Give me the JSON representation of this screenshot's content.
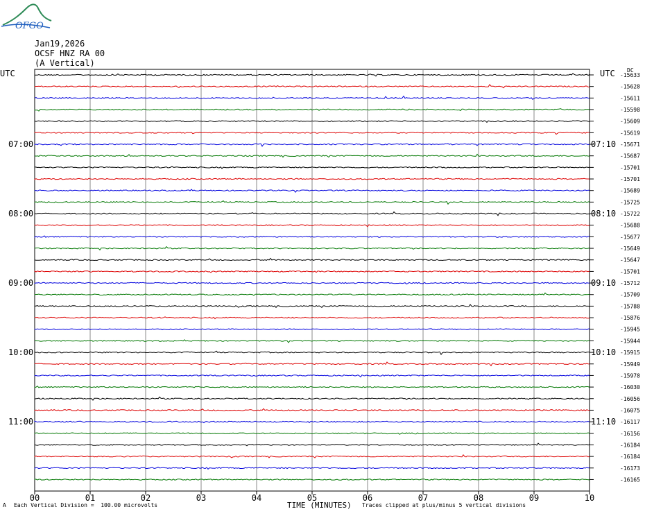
{
  "logo": {
    "text": "OFGO"
  },
  "header": {
    "date": "Jan19,2026",
    "station": "OCSF HNZ RA 00",
    "component": "(A Vertical)"
  },
  "left_timezone": "UTC",
  "right_timezone": "UTC",
  "dc_label": "DC",
  "footer": {
    "marker": "A",
    "division": "Each Vertical Division =  100.00 microvolts",
    "xlabel": "TIME (MINUTES)",
    "clip_note": "Traces clipped at plus/minus 5 vertical divisions"
  },
  "colors": {
    "cycle": [
      "#000000",
      "#dd0000",
      "#0000dd",
      "#007700"
    ],
    "grid": "#888888"
  },
  "chart_data": {
    "type": "line",
    "title": "OCSF HNZ RA 00 (A Vertical)",
    "xlabel": "TIME (MINUTES)",
    "ylabel": "",
    "xlim": [
      0,
      10
    ],
    "x_ticks": [
      "00",
      "01",
      "02",
      "03",
      "04",
      "05",
      "06",
      "07",
      "08",
      "09",
      "10"
    ],
    "left_time_labels": [
      {
        "row": 6,
        "label": "07:00"
      },
      {
        "row": 12,
        "label": "08:00"
      },
      {
        "row": 18,
        "label": "09:00"
      },
      {
        "row": 24,
        "label": "10:00"
      },
      {
        "row": 30,
        "label": "11:00"
      }
    ],
    "right_time_labels": [
      {
        "row": 6,
        "label": "07:10"
      },
      {
        "row": 12,
        "label": "08:10"
      },
      {
        "row": 18,
        "label": "09:10"
      },
      {
        "row": 24,
        "label": "10:10"
      },
      {
        "row": 30,
        "label": "11:10"
      }
    ],
    "dc_offsets": [
      -15633,
      -15628,
      -15611,
      -15598,
      -15609,
      -15619,
      -15671,
      -15687,
      -15701,
      -15701,
      -15689,
      -15725,
      -15722,
      -15688,
      -15677,
      -15649,
      -15647,
      -15701,
      -15712,
      -15709,
      -15788,
      -15876,
      -15945,
      -15944,
      -15915,
      -15949,
      -15978,
      -16030,
      -16056,
      -16075,
      -16117,
      -16156,
      -16184,
      -16184,
      -16173,
      -16165
    ],
    "grid": true
  }
}
